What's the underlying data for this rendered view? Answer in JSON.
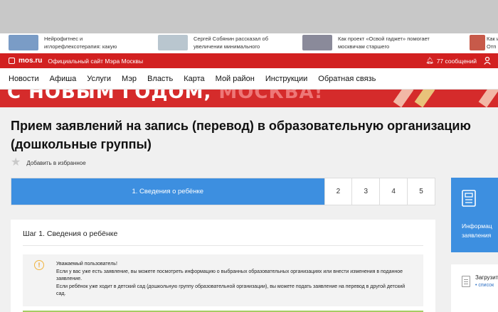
{
  "news": [
    {
      "text": "Нейрофитнес и иглорефлексотерапия: какую",
      "thumb_color": "#7a9cc6"
    },
    {
      "text": "Сергей Собянин рассказал об увеличении минимального",
      "thumb_color": "#b9c6cf"
    },
    {
      "text": "Как проект «Освой гаджет» помогает москвичам старшего",
      "thumb_color": "#8a8a9a"
    },
    {
      "text": "Как и\nОтп",
      "thumb_color": "#c75a4a"
    }
  ],
  "header": {
    "logo": "mos.ru",
    "official_site": "Официальный сайт Мэра Москвы",
    "messages": "77 сообщений"
  },
  "nav": [
    "Новости",
    "Афиша",
    "Услуги",
    "Мэр",
    "Власть",
    "Карта",
    "Мой район",
    "Инструкции",
    "Обратная связь"
  ],
  "banner": {
    "text_main": "С НОВЫМ ГОДОМ, ",
    "text_city": "МОСКВА!"
  },
  "page": {
    "title": "Прием заявлений на запись (перевод) в образовательную организацию (дошкольные группы)",
    "favorite": "Добавить в избранное"
  },
  "steps": {
    "active": "1. Сведения о ребёнке",
    "others": [
      "2",
      "3",
      "4",
      "5"
    ]
  },
  "form": {
    "step_title": "Шаг 1. Сведения о ребёнке",
    "notice_lines": [
      "Уважаемый пользователь!",
      "Если у вас уже есть заявление, вы можете посмотреть информацию о выбранных образовательных организациях или внести изменения в поданное заявление.",
      "Если ребёнок уже ходит в детский сад (дошкольную группу образовательной организации), вы можете подать заявление на перевод в другой детский сад."
    ]
  },
  "sidebar": {
    "info_label_1": "Информац",
    "info_label_2": "заявления",
    "download_label": "Загрузит",
    "download_link": "• список"
  },
  "colors": {
    "accent_red": "#d22020",
    "accent_blue": "#3d8fe0",
    "notice_green": "#a6cc63"
  }
}
